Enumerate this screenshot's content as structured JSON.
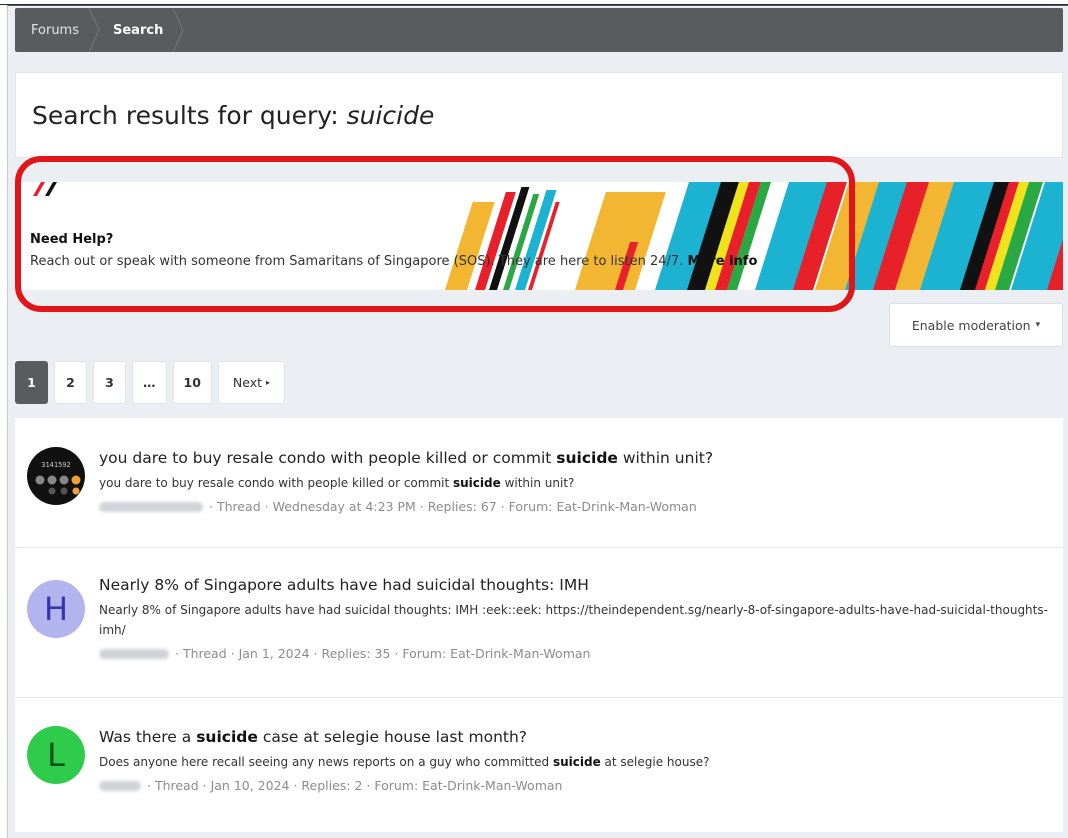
{
  "breadcrumb": {
    "items": [
      "Forums",
      "Search"
    ]
  },
  "page": {
    "title_prefix": "Search results for query:",
    "query": "suicide"
  },
  "banner": {
    "heading": "Need Help?",
    "text": "Reach out or speak with someone from Samaritans of Singapore (SOS). They are here to listen 24/7.",
    "link": "More info",
    "stripe_colors": [
      "#f3b632",
      "#1bb3d1",
      "#e8202a",
      "#111111",
      "#29a844",
      "#f0e21b"
    ]
  },
  "moderation": {
    "label": "Enable moderation",
    "caret": "▾"
  },
  "pagination": {
    "pages": [
      "1",
      "2",
      "3",
      "…",
      "10"
    ],
    "current": "1",
    "next_label": "Next",
    "next_arrow": "▸"
  },
  "results": [
    {
      "title_pre": "you dare to buy resale condo with people killed or commit ",
      "title_bold": "suicide",
      "title_post": " within unit?",
      "snippet_pre": "you dare to buy resale condo with people killed or commit ",
      "snippet_bold": "suicide",
      "snippet_post": " within unit?",
      "meta": "· Thread · Wednesday at 4:23 PM · Replies: 67 · Forum: Eat-Drink-Man-Woman",
      "avatar": {
        "type": "calculator-icon",
        "letter": "",
        "bg": "#111111",
        "digits": "3141592"
      }
    },
    {
      "title_pre": "Nearly 8% of Singapore adults have had suicidal thoughts: IMH",
      "title_bold": "",
      "title_post": "",
      "snippet_pre": "Nearly 8% of Singapore adults have had suicidal thoughts: IMH :eek::eek: https://theindependent.sg/nearly-8-of-singapore-adults-have-had-suicidal-thoughts-imh/",
      "snippet_bold": "",
      "snippet_post": "",
      "meta": "· Thread · Jan 1, 2024 · Replies: 35 · Forum: Eat-Drink-Man-Woman",
      "avatar": {
        "type": "letter",
        "letter": "H",
        "bg": "#b3b3ee",
        "fg": "#3535b0"
      }
    },
    {
      "title_pre": "Was there a ",
      "title_bold": "suicide",
      "title_post": " case at selegie house last month?",
      "snippet_pre": "Does anyone here recall seeing any news reports on a guy who committed ",
      "snippet_bold": "suicide",
      "snippet_post": " at selegie house?",
      "meta": "· Thread · Jan 10, 2024 · Replies: 2 · Forum: Eat-Drink-Man-Woman",
      "avatar": {
        "type": "letter",
        "letter": "L",
        "bg": "#2ecc4a",
        "fg": "#0d5218"
      }
    }
  ]
}
